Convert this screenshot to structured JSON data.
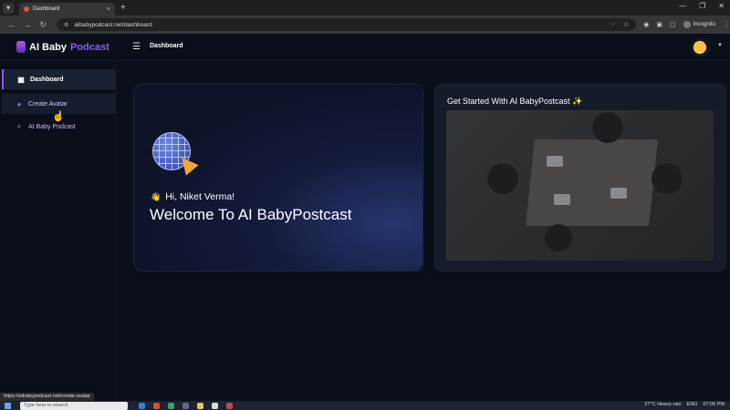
{
  "browser": {
    "tab_title": "Dashboard",
    "tab_close": "×",
    "new_tab": "+",
    "url": "aibabypodcast.net/dashboard",
    "profile_label": "Incognito",
    "status_url": "https://aibabypodcast.net/create-avatar"
  },
  "app": {
    "logo_ai_baby": "AI Baby",
    "logo_podcast": "Podcast",
    "breadcrumb": "Dashboard",
    "accent_color": "#8a5cf7"
  },
  "sidebar": {
    "items": [
      {
        "label": "Dashboard",
        "icon": "dashboard-icon"
      },
      {
        "label": "Create Avatar",
        "icon": "user-icon"
      },
      {
        "label": "AI Baby Podcast",
        "icon": "podcast-search-icon"
      }
    ]
  },
  "welcome_card": {
    "greeting": "Hi, Niket Verma!",
    "heading": "Welcome To AI BabyPostcast"
  },
  "started_card": {
    "title": "Get Started With AI BabyPostcast ✨"
  },
  "taskbar": {
    "search_placeholder": "Type here to search",
    "weather": "27°C  Heavy rain",
    "language": "ENG",
    "time": "07:00 PM"
  }
}
